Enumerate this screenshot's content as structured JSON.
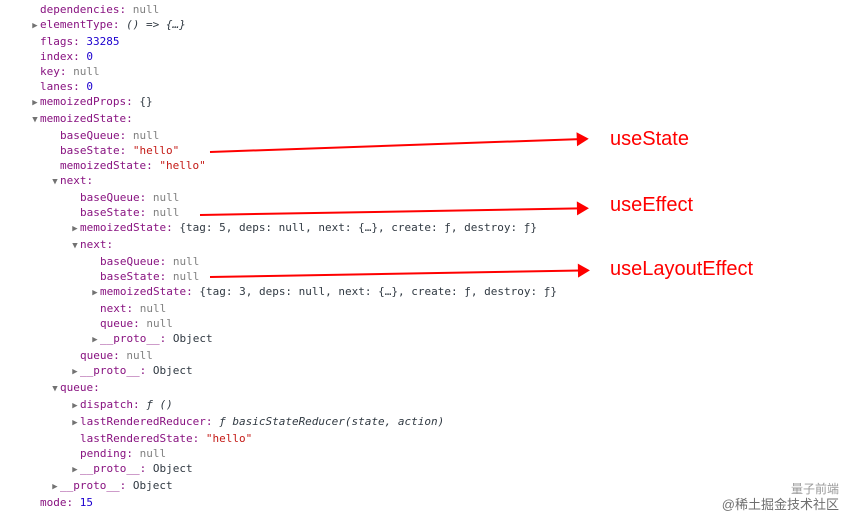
{
  "lines": {
    "dependencies": "dependencies",
    "dependencies_val": "null",
    "elementType": "elementType",
    "elementType_val": "() => {…}",
    "flags": "flags",
    "flags_val": "33285",
    "index": "index",
    "index_val": "0",
    "key": "key",
    "key_val": "null",
    "lanes": "lanes",
    "lanes_val": "0",
    "memoizedProps": "memoizedProps",
    "memoizedProps_val": "{}",
    "memoizedState": "memoizedState",
    "baseQueue": "baseQueue",
    "baseQueue_val": "null",
    "baseState": "baseState",
    "baseState_hello": "\"hello\"",
    "baseState_valnull": "null",
    "memoizedState_inner": "memoizedState",
    "memoizedState_hello": "\"hello\"",
    "next": "next",
    "next_val_null": "null",
    "memoizedState_obj5": "{tag: 5, deps: null, next: {…}, create: ƒ, destroy: ƒ}",
    "memoizedState_obj3": "{tag: 3, deps: null, next: {…}, create: ƒ, destroy: ƒ}",
    "queue": "queue",
    "queue_val_null": "null",
    "proto": "__proto__",
    "proto_val": "Object",
    "dispatch": "dispatch",
    "dispatch_val": "ƒ ()",
    "lastRenderedReducer": "lastRenderedReducer",
    "lastRenderedReducer_val": "ƒ basicStateReducer(state, action)",
    "lastRenderedState": "lastRenderedState",
    "lastRenderedState_val": "\"hello\"",
    "pending": "pending",
    "pending_val": "null",
    "mode": "mode",
    "mode_val": "15"
  },
  "annotations": {
    "a1": "useState",
    "a2": "useEffect",
    "a3": "useLayoutEffect"
  },
  "watermark": {
    "line1": "量子前端",
    "line2": "@稀土掘金技术社区"
  }
}
